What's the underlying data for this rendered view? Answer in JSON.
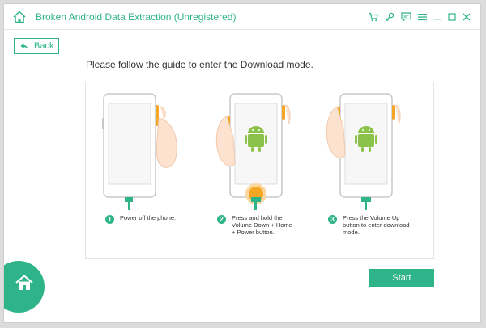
{
  "app": {
    "title": "Broken Android Data Extraction (Unregistered)"
  },
  "toolbar": {
    "icons": [
      "cart-icon",
      "key-icon",
      "chat-icon",
      "menu-icon",
      "minimize-icon",
      "maximize-icon",
      "close-icon"
    ]
  },
  "nav": {
    "back_label": "Back"
  },
  "guide": {
    "instruction": "Please follow the guide to enter the Download mode."
  },
  "steps": [
    {
      "number": "1",
      "text": "Power off the phone."
    },
    {
      "number": "2",
      "text": "Press and hold the Volume Down + Home + Power button."
    },
    {
      "number": "3",
      "text": "Press the Volume Up button to enter download mode."
    }
  ],
  "actions": {
    "start_label": "Start"
  },
  "colors": {
    "accent": "#2fb489",
    "highlight": "#f5a623",
    "android": "#8bc34a"
  }
}
